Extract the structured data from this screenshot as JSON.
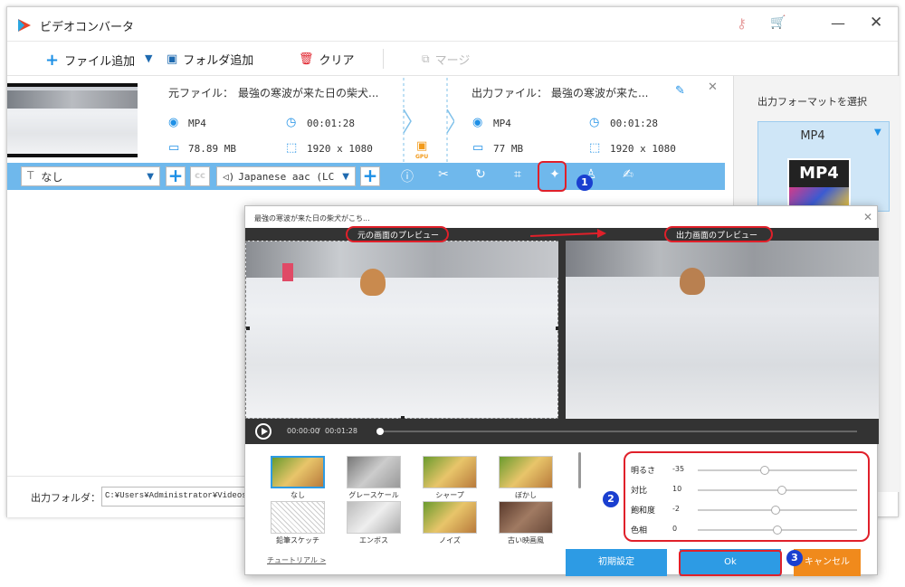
{
  "app": {
    "title": "ビデオコンバータ",
    "window_controls": [
      "key-icon",
      "cart-icon",
      "minimize-icon",
      "close-icon"
    ]
  },
  "toolbar": {
    "add_file": "ファイル追加",
    "add_folder": "フォルダ追加",
    "clear": "クリア",
    "merge": "マージ"
  },
  "file": {
    "source_label": "元ファイル：",
    "source_name": "最強の寒波が来た日の柴犬...",
    "output_label": "出力ファイル：",
    "output_name": "最強の寒波が来た...",
    "src_format": "MP4",
    "src_duration": "00:01:28",
    "src_size": "78.89 MB",
    "src_resolution": "1920 x 1080",
    "out_format": "MP4",
    "out_duration": "00:01:28",
    "out_size": "77 MB",
    "out_resolution": "1920 x 1080",
    "gpu_label": "GPU"
  },
  "edit_bar": {
    "subtitle_value": "なし",
    "audio_value": "Japanese aac (LC"
  },
  "right_panel": {
    "title": "出力フォーマットを選択",
    "format": "MP4",
    "format_icon_text": "MP4"
  },
  "output_folder": {
    "label": "出力フォルダ：",
    "path": "C:¥Users¥Administrator¥Videos¥Wo"
  },
  "dialog": {
    "title": "最強の寒波が来た日の柴犬がこち...",
    "source_preview_label": "元の画面のプレビュー",
    "output_preview_label": "出力画面のプレビュー",
    "time_current": "00:00:00",
    "time_separator": "/",
    "time_total": "00:01:28",
    "filters": [
      {
        "label": "なし",
        "style": "color"
      },
      {
        "label": "グレースケール",
        "style": "gray"
      },
      {
        "label": "シャープ",
        "style": "color"
      },
      {
        "label": "ぼかし",
        "style": "color"
      },
      {
        "label": "鉛筆スケッチ",
        "style": "sketch"
      },
      {
        "label": "エンボス",
        "style": "emboss"
      },
      {
        "label": "ノイズ",
        "style": "color"
      },
      {
        "label": "古い映画風",
        "style": "old"
      }
    ],
    "sliders": [
      {
        "label": "明るさ",
        "value": "-35",
        "level": 0.42
      },
      {
        "label": "対比",
        "value": "10",
        "level": 0.53
      },
      {
        "label": "飽和度",
        "value": "-2",
        "level": 0.49
      },
      {
        "label": "色相",
        "value": "0",
        "level": 0.5
      }
    ],
    "tutorial": "チュートリアル >",
    "reset": "初期設定",
    "ok": "Ok",
    "cancel": "キャンセル"
  },
  "steps": [
    "1",
    "2",
    "3"
  ],
  "colors": {
    "accent": "#1e90e6",
    "edit_bar": "#6fb8ec",
    "ok": "#2d9be4",
    "cancel": "#f08a1c",
    "annotation": "#e0202a",
    "step": "#1a3fd0"
  }
}
